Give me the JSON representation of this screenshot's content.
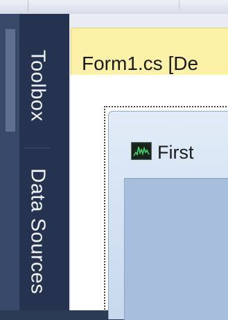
{
  "side_tabs": {
    "toolbox_label": "Toolbox",
    "data_sources_label": "Data Sources"
  },
  "document_tab": {
    "title": "Form1.cs [De"
  },
  "designer": {
    "form_title": "First"
  },
  "colors": {
    "side_panel": "#253350",
    "document_tab": "#fbf1a7",
    "form_client": "#a7bfdc"
  },
  "icons": {
    "form_icon": "monitor-chart-icon"
  }
}
